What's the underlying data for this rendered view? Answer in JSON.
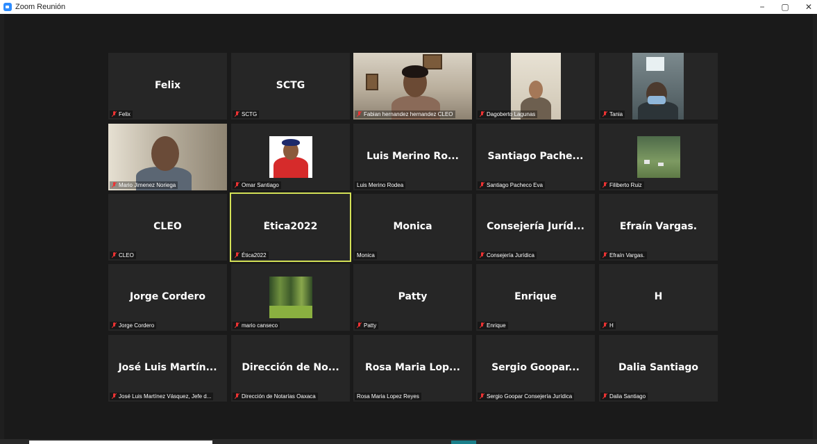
{
  "window": {
    "title": "Zoom Reunión",
    "minimize": "−",
    "maximize": "▢",
    "close": "✕"
  },
  "tiles": [
    {
      "name": "Felix",
      "label": "Felix",
      "muted": true
    },
    {
      "name": "SCTG",
      "label": "SCTG",
      "muted": true
    },
    {
      "name": "",
      "label": "Fabian hernandez hernandez CLEO",
      "muted": true,
      "video": true
    },
    {
      "name": "",
      "label": "Dagoberto Lagunas",
      "muted": true,
      "video": true
    },
    {
      "name": "",
      "label": "Tania",
      "muted": true,
      "video": true
    },
    {
      "name": "",
      "label": "Mario Jimenez Noriega",
      "muted": true,
      "video": true
    },
    {
      "name": "",
      "label": "Omar Santiago",
      "muted": true,
      "video": true
    },
    {
      "name": "Luis Merino Ro...",
      "label": "Luis Merino Rodea",
      "muted": false
    },
    {
      "name": "Santiago Pache...",
      "label": "Santiago Pacheco Eva",
      "muted": true
    },
    {
      "name": "",
      "label": "Filiberto Ruiz",
      "muted": true,
      "video": true
    },
    {
      "name": "CLEO",
      "label": "CLEO",
      "muted": true
    },
    {
      "name": "Ética2022",
      "label": "Ética2022",
      "muted": true,
      "active": true
    },
    {
      "name": "Monica",
      "label": "Monica",
      "muted": false
    },
    {
      "name": "Consejería Juríd...",
      "label": "Consejería Jurídica",
      "muted": true
    },
    {
      "name": "Efraín Vargas.",
      "label": "Efraín Vargas.",
      "muted": true
    },
    {
      "name": "Jorge Cordero",
      "label": "Jorge Cordero",
      "muted": true
    },
    {
      "name": "",
      "label": "mario canseco",
      "muted": true,
      "video": true
    },
    {
      "name": "Patty",
      "label": "Patty",
      "muted": true
    },
    {
      "name": "Enrique",
      "label": "Enrique",
      "muted": true
    },
    {
      "name": "H",
      "label": "H",
      "muted": true
    },
    {
      "name": "José Luis Martín...",
      "label": "José Luis Martínez Vásquez, Jefe d...",
      "muted": true
    },
    {
      "name": "Dirección de No...",
      "label": "Dirección de Notarías Oaxaca",
      "muted": true
    },
    {
      "name": "Rosa Maria Lop...",
      "label": "Rosa Maria Lopez Reyes",
      "muted": false
    },
    {
      "name": "Sergio Goopar...",
      "label": "Sergio Goopar Consejería Jurídica",
      "muted": true
    },
    {
      "name": "Dalia Santiago",
      "label": "Dalia Santiago",
      "muted": true
    }
  ],
  "colors": {
    "background": "#1f1f1f",
    "tile": "#262626",
    "active_border": "#d4e157",
    "muted": "#e33333"
  }
}
